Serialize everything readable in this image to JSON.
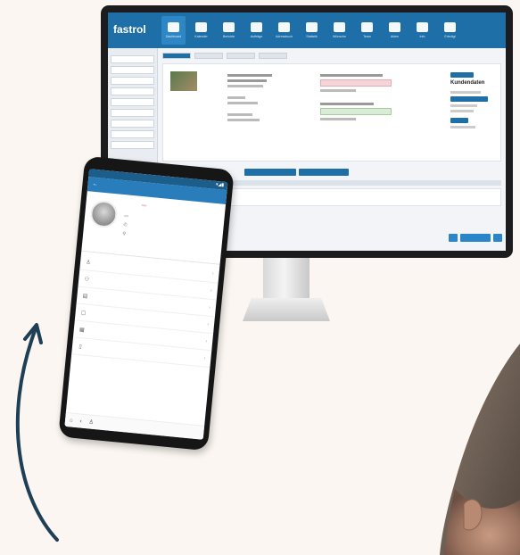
{
  "monitor": {
    "logo": "fastrol",
    "logo_sub": "",
    "nav": [
      {
        "label": "Dashboard",
        "icon": "home-icon",
        "active": true
      },
      {
        "label": "Kalender",
        "icon": "calendar-icon"
      },
      {
        "label": "Berichte",
        "icon": "chat-icon"
      },
      {
        "label": "Aufträge",
        "icon": "tools-icon"
      },
      {
        "label": "Adressbuch",
        "icon": "contacts-icon"
      },
      {
        "label": "Statistik",
        "icon": "chart-icon"
      },
      {
        "label": "Wünsche",
        "icon": "heart-icon"
      },
      {
        "label": "Team",
        "icon": "team-icon"
      },
      {
        "label": "Akten",
        "icon": "briefcase-icon"
      },
      {
        "label": "Info",
        "icon": "flag-icon"
      },
      {
        "label": "Erledigt",
        "icon": "check-icon"
      }
    ],
    "side_heading": "",
    "side_items": [
      "",
      "",
      "",
      "",
      "",
      "",
      "",
      "",
      ""
    ],
    "breadcrumb": "",
    "right_title": "Kundendaten",
    "actions": [
      "",
      ""
    ],
    "bottom_buttons": [
      "",
      ""
    ]
  },
  "phone": {
    "status_time": "",
    "status_icons": "▾◢▮",
    "title": "",
    "name": "",
    "badge": "",
    "detail_lines": [
      "",
      "",
      ""
    ],
    "avatar_caption": "",
    "menu": [
      {
        "label": "",
        "icon": "person-icon"
      },
      {
        "label": "",
        "icon": "people-icon"
      },
      {
        "label": "",
        "icon": "document-icon"
      },
      {
        "label": "",
        "icon": "chat-icon"
      },
      {
        "label": "",
        "icon": "calendar-icon"
      },
      {
        "label": "",
        "icon": "file-icon"
      }
    ]
  },
  "colors": {
    "primary": "#1e6ea8",
    "accent": "#2a7dbb",
    "arrow": "#1f3f57",
    "background": "#fbf6f1",
    "badge_bg": "#f7c7c9"
  }
}
